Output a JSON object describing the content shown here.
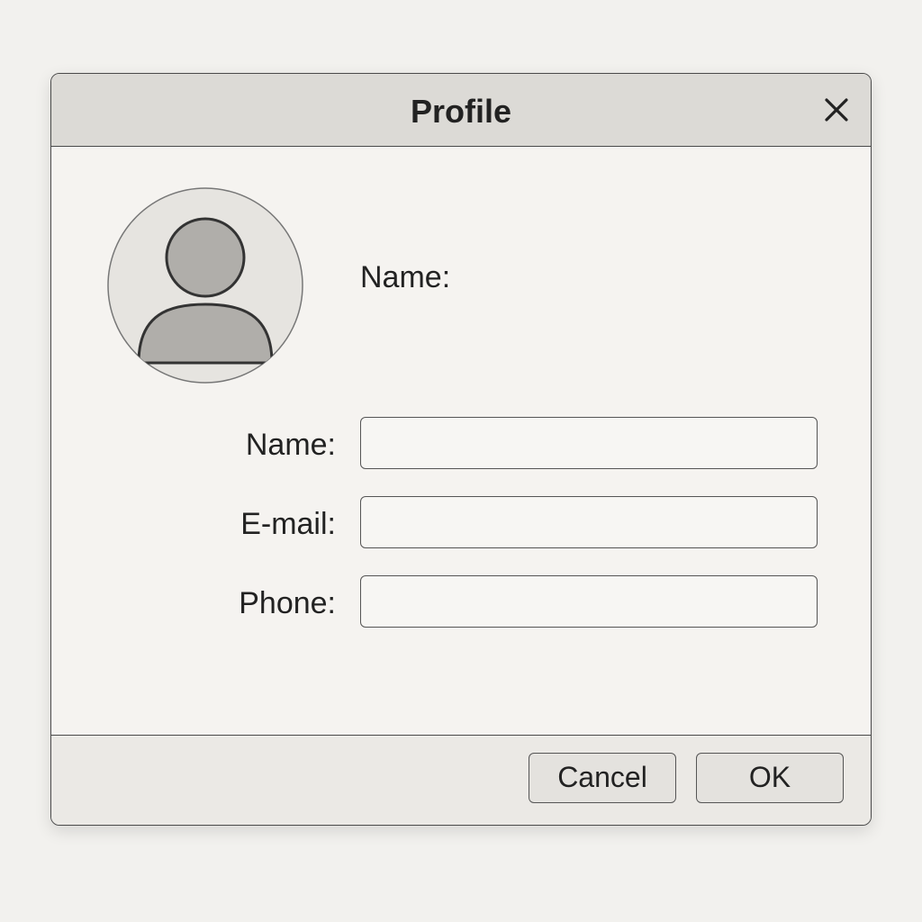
{
  "dialog": {
    "title": "Profile",
    "close_icon": "close-icon"
  },
  "profile": {
    "avatar_icon": "user-avatar-icon",
    "name_display_label": "Name:"
  },
  "form": {
    "fields": [
      {
        "label": "Name:",
        "value": "",
        "placeholder": ""
      },
      {
        "label": "E-mail:",
        "value": "",
        "placeholder": ""
      },
      {
        "label": "Phone:",
        "value": "",
        "placeholder": ""
      }
    ]
  },
  "footer": {
    "cancel_label": "Cancel",
    "ok_label": "OK"
  },
  "colors": {
    "background": "#f2f1ee",
    "titlebar": "#dcdad6",
    "border": "#4a4a4a",
    "avatar_fill": "#b0aeaa"
  }
}
